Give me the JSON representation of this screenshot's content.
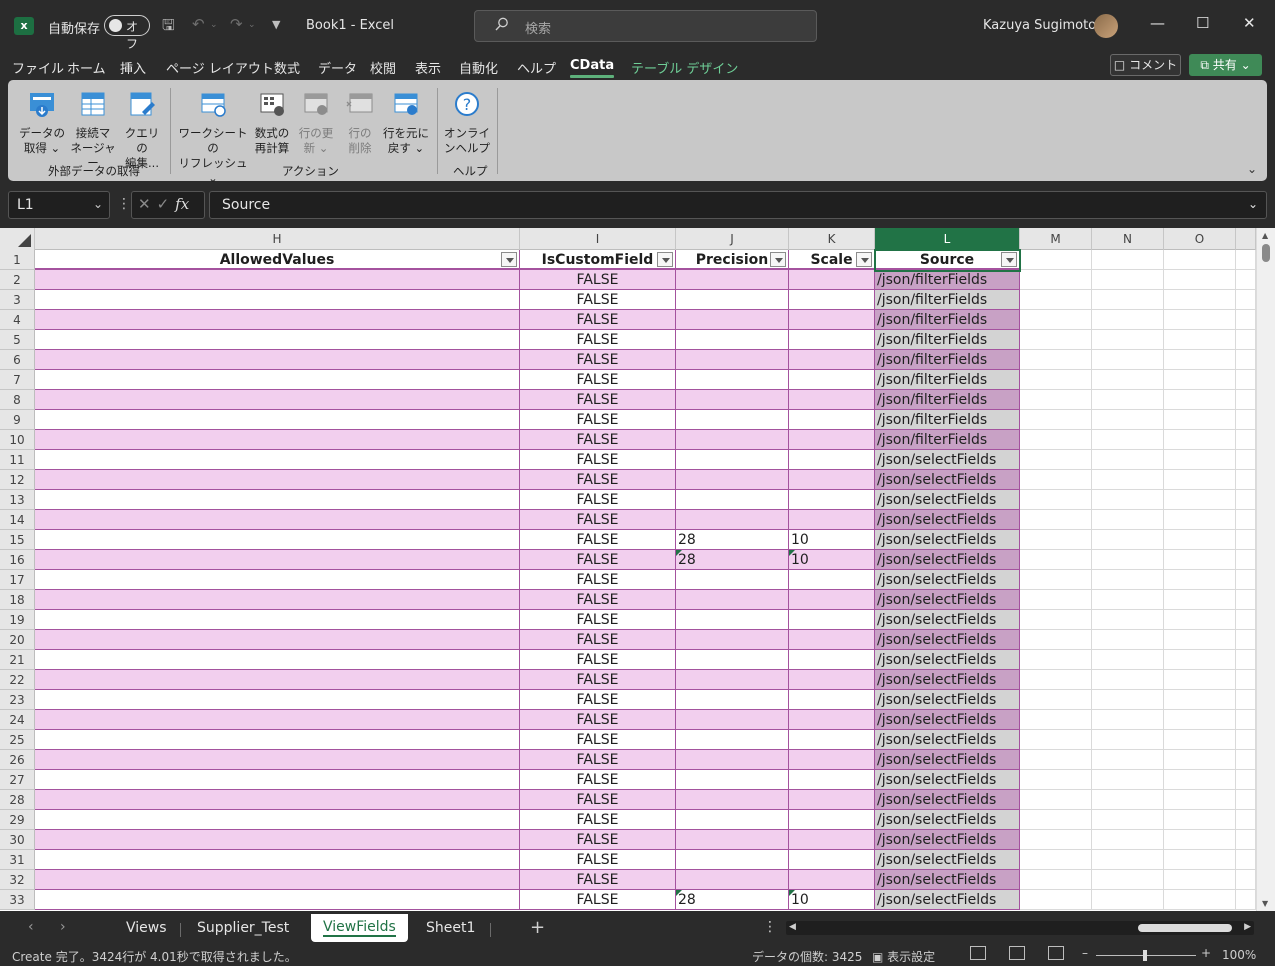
{
  "titlebar": {
    "app_logo": "excel-logo",
    "logo_letter": "x",
    "autosave_label": "自動保存",
    "autosave_state": "オフ",
    "document_title": "Book1  -  Excel",
    "search_placeholder": "検索",
    "user_name": "Kazuya Sugimoto"
  },
  "ribbon_tabs": [
    "ファイル",
    "ホーム",
    "挿入",
    "ページ レイアウト",
    "数式",
    "データ",
    "校閲",
    "表示",
    "自動化",
    "ヘルプ",
    "CData",
    "テーブル デザイン"
  ],
  "active_tab": "CData",
  "comment_button": "コメント",
  "share_button": "共有",
  "ribbon": {
    "groups": [
      {
        "label": "外部データの取得",
        "items": [
          {
            "line1": "データの",
            "line2": "取得 ⌄",
            "icon": "cdata-get-data-icon",
            "enabled": true
          },
          {
            "line1": "接続マ",
            "line2": "ネージャー",
            "icon": "connection-manager-icon",
            "enabled": true
          },
          {
            "line1": "クエリの",
            "line2": "編集...",
            "icon": "edit-query-icon",
            "enabled": true
          }
        ]
      },
      {
        "label": "アクション",
        "items": [
          {
            "line1": "ワークシートの",
            "line2": "リフレッシュ ⌄",
            "icon": "refresh-sheet-icon",
            "enabled": true
          },
          {
            "line1": "数式の",
            "line2": "再計算",
            "icon": "recalculate-icon",
            "enabled": true
          },
          {
            "line1": "行の更",
            "line2": "新 ⌄",
            "icon": "update-rows-icon",
            "enabled": false
          },
          {
            "line1": "行の",
            "line2": "削除",
            "icon": "delete-rows-icon",
            "enabled": false
          },
          {
            "line1": "行を元に",
            "line2": "戻す ⌄",
            "icon": "revert-rows-icon",
            "enabled": true
          }
        ]
      },
      {
        "label": "ヘルプ",
        "items": [
          {
            "line1": "オンライ",
            "line2": "ンヘルプ",
            "icon": "online-help-icon",
            "enabled": true
          }
        ]
      }
    ]
  },
  "formula_bar": {
    "name_box": "L1",
    "formula": "Source"
  },
  "grid": {
    "columns": [
      "H",
      "I",
      "J",
      "K",
      "L",
      "M",
      "N",
      "O"
    ],
    "selected_column": "L",
    "headers": {
      "H": "AllowedValues",
      "I": "IsCustomField",
      "J": "Precision",
      "K": "Scale",
      "L": "Source"
    },
    "rows": [
      {
        "n": "2",
        "I": "FALSE",
        "J": "",
        "K": "",
        "L": "/json/filterFields"
      },
      {
        "n": "3",
        "I": "FALSE",
        "J": "",
        "K": "",
        "L": "/json/filterFields"
      },
      {
        "n": "4",
        "I": "FALSE",
        "J": "",
        "K": "",
        "L": "/json/filterFields"
      },
      {
        "n": "5",
        "I": "FALSE",
        "J": "",
        "K": "",
        "L": "/json/filterFields"
      },
      {
        "n": "6",
        "I": "FALSE",
        "J": "",
        "K": "",
        "L": "/json/filterFields"
      },
      {
        "n": "7",
        "I": "FALSE",
        "J": "",
        "K": "",
        "L": "/json/filterFields"
      },
      {
        "n": "8",
        "I": "FALSE",
        "J": "",
        "K": "",
        "L": "/json/filterFields"
      },
      {
        "n": "9",
        "I": "FALSE",
        "J": "",
        "K": "",
        "L": "/json/filterFields"
      },
      {
        "n": "10",
        "I": "FALSE",
        "J": "",
        "K": "",
        "L": "/json/filterFields"
      },
      {
        "n": "11",
        "I": "FALSE",
        "J": "",
        "K": "",
        "L": "/json/selectFields"
      },
      {
        "n": "12",
        "I": "FALSE",
        "J": "",
        "K": "",
        "L": "/json/selectFields"
      },
      {
        "n": "13",
        "I": "FALSE",
        "J": "",
        "K": "",
        "L": "/json/selectFields"
      },
      {
        "n": "14",
        "I": "FALSE",
        "J": "",
        "K": "",
        "L": "/json/selectFields"
      },
      {
        "n": "15",
        "I": "FALSE",
        "J": "28",
        "K": "10",
        "L": "/json/selectFields"
      },
      {
        "n": "16",
        "I": "FALSE",
        "J": "28",
        "K": "10",
        "L": "/json/selectFields"
      },
      {
        "n": "17",
        "I": "FALSE",
        "J": "",
        "K": "",
        "L": "/json/selectFields"
      },
      {
        "n": "18",
        "I": "FALSE",
        "J": "",
        "K": "",
        "L": "/json/selectFields"
      },
      {
        "n": "19",
        "I": "FALSE",
        "J": "",
        "K": "",
        "L": "/json/selectFields"
      },
      {
        "n": "20",
        "I": "FALSE",
        "J": "",
        "K": "",
        "L": "/json/selectFields"
      },
      {
        "n": "21",
        "I": "FALSE",
        "J": "",
        "K": "",
        "L": "/json/selectFields"
      },
      {
        "n": "22",
        "I": "FALSE",
        "J": "",
        "K": "",
        "L": "/json/selectFields"
      },
      {
        "n": "23",
        "I": "FALSE",
        "J": "",
        "K": "",
        "L": "/json/selectFields"
      },
      {
        "n": "24",
        "I": "FALSE",
        "J": "",
        "K": "",
        "L": "/json/selectFields"
      },
      {
        "n": "25",
        "I": "FALSE",
        "J": "",
        "K": "",
        "L": "/json/selectFields"
      },
      {
        "n": "26",
        "I": "FALSE",
        "J": "",
        "K": "",
        "L": "/json/selectFields"
      },
      {
        "n": "27",
        "I": "FALSE",
        "J": "",
        "K": "",
        "L": "/json/selectFields"
      },
      {
        "n": "28",
        "I": "FALSE",
        "J": "",
        "K": "",
        "L": "/json/selectFields"
      },
      {
        "n": "29",
        "I": "FALSE",
        "J": "",
        "K": "",
        "L": "/json/selectFields"
      },
      {
        "n": "30",
        "I": "FALSE",
        "J": "",
        "K": "",
        "L": "/json/selectFields"
      },
      {
        "n": "31",
        "I": "FALSE",
        "J": "",
        "K": "",
        "L": "/json/selectFields"
      },
      {
        "n": "32",
        "I": "FALSE",
        "J": "",
        "K": "",
        "L": "/json/selectFields"
      },
      {
        "n": "33",
        "I": "FALSE",
        "J": "28",
        "K": "10",
        "L": "/json/selectFields"
      }
    ]
  },
  "sheet_tabs": [
    "Views",
    "Supplier_Test",
    "ViewFields",
    "Sheet1"
  ],
  "active_sheet": "ViewFields",
  "status": {
    "message": "Create 完了。3424行が 4.01秒で取得されました。",
    "count": "データの個数: 3425",
    "display_settings": "表示設定",
    "zoom": "100%"
  },
  "colors": {
    "accent": "#217346",
    "band_pink": "#f2cfee",
    "source_pink": "#c8a1c5",
    "source_gray": "#d3d3d3",
    "table_border": "#a4529e"
  }
}
